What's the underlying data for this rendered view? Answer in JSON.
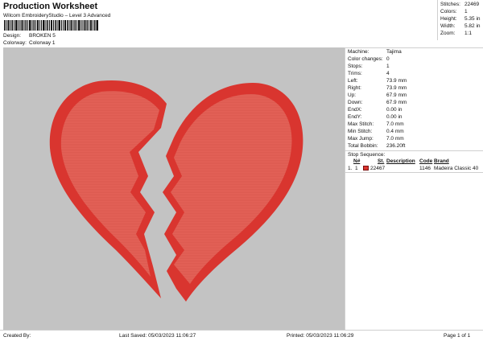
{
  "header": {
    "title": "Production Worksheet",
    "subtitle": "Wilcom EmbroideryStudio – Level 3 Advanced",
    "design_label": "Design:",
    "design_value": "BROKEN 5",
    "colorway_label": "Colorway:",
    "colorway_value": "Colorway 1"
  },
  "top_stats": [
    {
      "label": "Stitches:",
      "value": "22469"
    },
    {
      "label": "Colors:",
      "value": "1"
    },
    {
      "label": "Height:",
      "value": "5.35 in"
    },
    {
      "label": "Width:",
      "value": "5.82 in"
    },
    {
      "label": "Zoom:",
      "value": "1:1"
    }
  ],
  "machine_info": [
    {
      "label": "Machine:",
      "value": "Tajima"
    },
    {
      "label": "Color changes:",
      "value": "0"
    },
    {
      "label": "Stops:",
      "value": "1"
    },
    {
      "label": "Trims:",
      "value": "4"
    },
    {
      "label": "Left:",
      "value": "73.9 mm"
    },
    {
      "label": "Right:",
      "value": "73.9 mm"
    },
    {
      "label": "Up:",
      "value": "67.9 mm"
    },
    {
      "label": "Down:",
      "value": "67.9 mm"
    },
    {
      "label": "EndX:",
      "value": "0.00 in"
    },
    {
      "label": "EndY:",
      "value": "0.00 in"
    },
    {
      "label": "Max Stitch:",
      "value": "7.0 mm"
    },
    {
      "label": "Min Stitch:",
      "value": "0.4 mm"
    },
    {
      "label": "Max Jump:",
      "value": "7.0 mm"
    },
    {
      "label": "Total Bobbin:",
      "value": "236.20ft"
    }
  ],
  "stop_sequence": {
    "title": "Stop Sequence:",
    "columns": [
      "N#",
      "St.",
      "Description",
      "Code",
      "Brand"
    ],
    "rows": [
      {
        "index": "1.",
        "n": "1",
        "swatch_color": "#d9352f",
        "stitches": "22467",
        "description": "",
        "code": "1146",
        "brand": "Madeira Classic 40"
      }
    ]
  },
  "design_colors": {
    "fill": "#e46258",
    "outline": "#d9352f",
    "canvas_bg": "#c3c3c3"
  },
  "footer": {
    "created_by": "Created By:",
    "last_saved": "Last Saved: 05/03/2023 11:06:27",
    "printed": "Printed: 05/03/2023 11:06:29",
    "page": "Page 1 of 1"
  }
}
